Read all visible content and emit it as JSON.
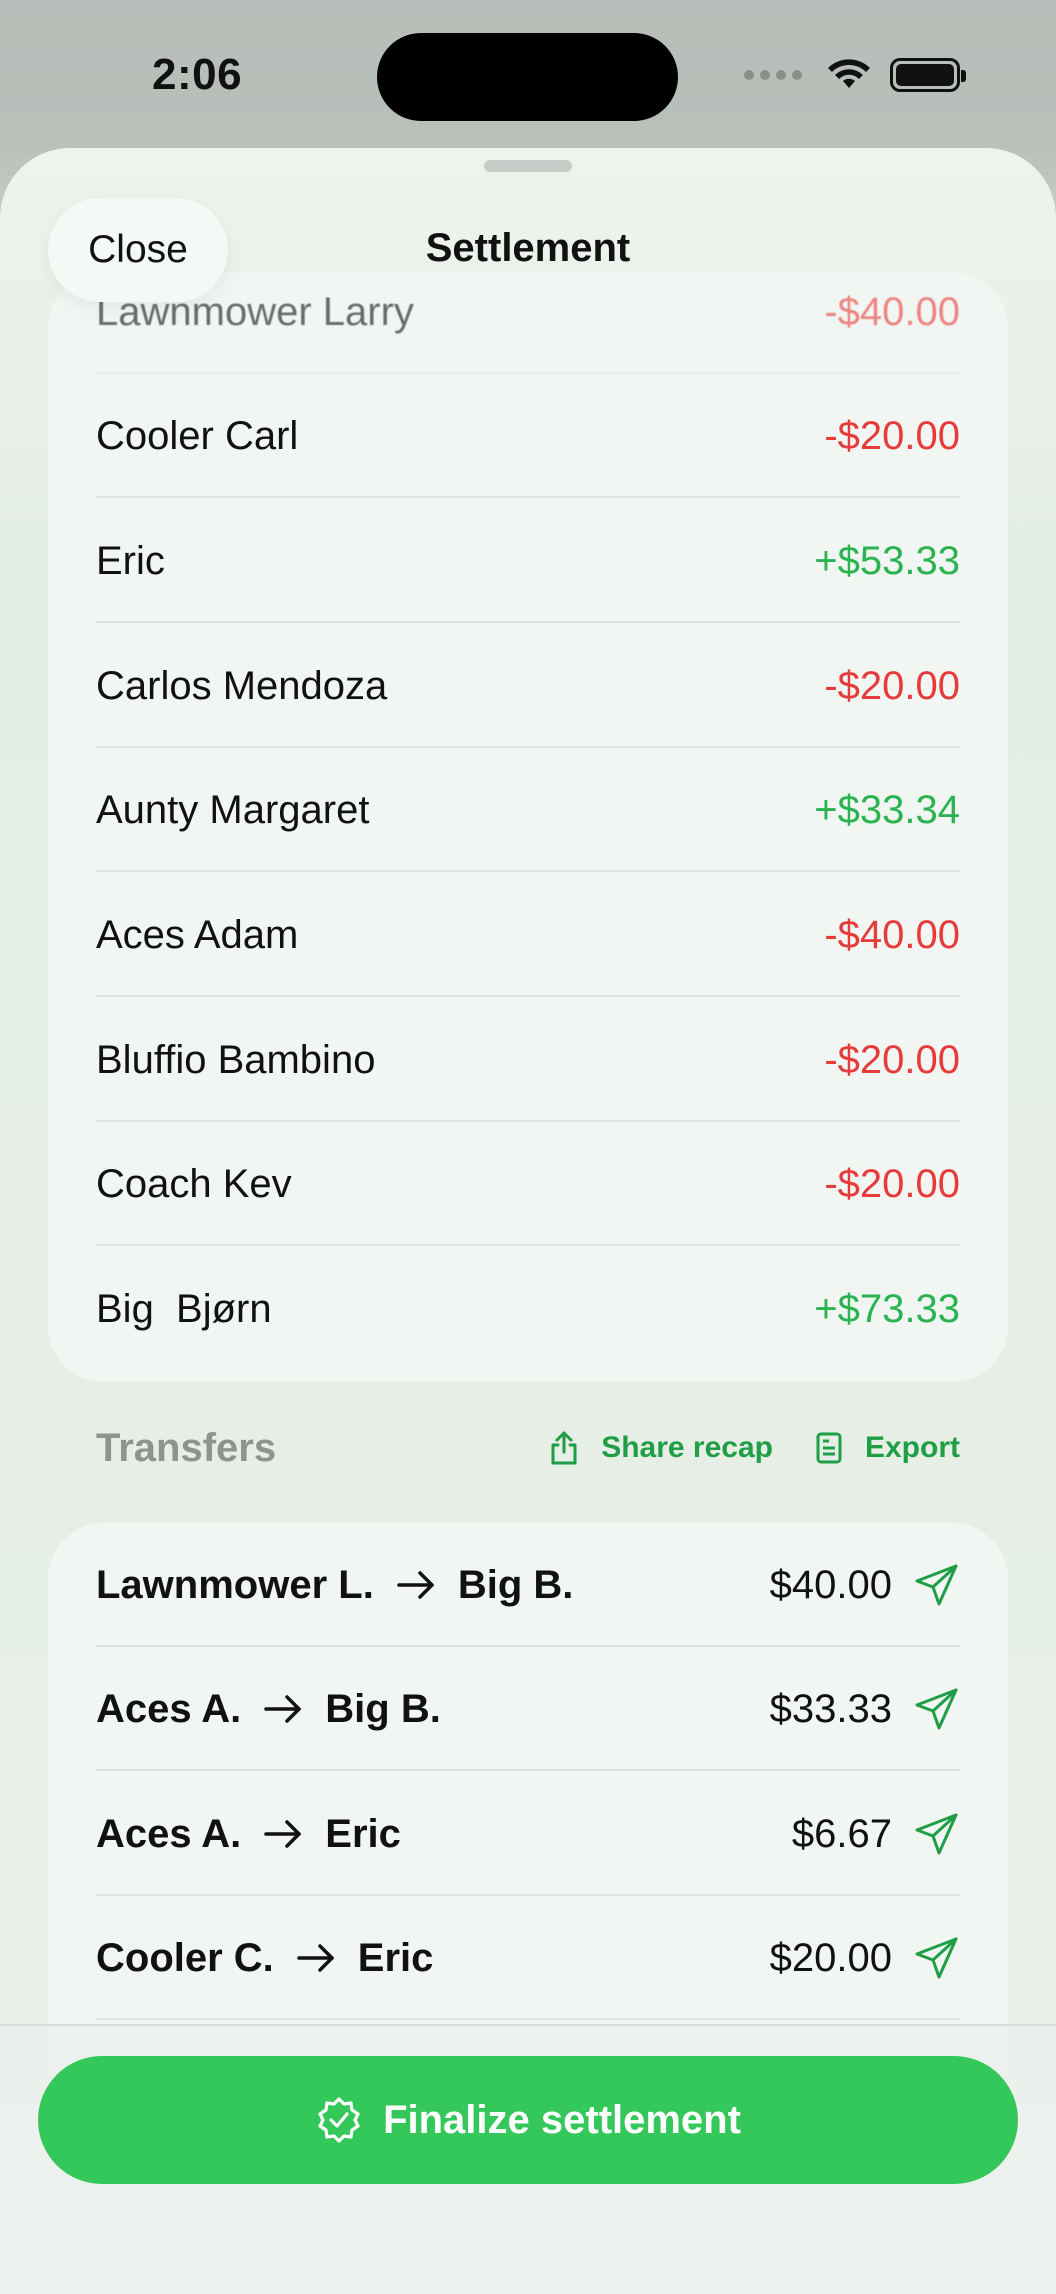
{
  "status": {
    "time": "2:06"
  },
  "sheet": {
    "close_label": "Close",
    "title": "Settlement"
  },
  "balances": [
    {
      "name": "Lawnmower Larry",
      "amount": "-$40.00",
      "sign": "neg"
    },
    {
      "name": "Cooler Carl",
      "amount": "-$20.00",
      "sign": "neg"
    },
    {
      "name": "Eric",
      "amount": "+$53.33",
      "sign": "pos"
    },
    {
      "name": "Carlos Mendoza",
      "amount": "-$20.00",
      "sign": "neg"
    },
    {
      "name": "Aunty Margaret",
      "amount": "+$33.34",
      "sign": "pos"
    },
    {
      "name": "Aces Adam",
      "amount": "-$40.00",
      "sign": "neg"
    },
    {
      "name": "Bluffio Bambino",
      "amount": "-$20.00",
      "sign": "neg"
    },
    {
      "name": "Coach Kev",
      "amount": "-$20.00",
      "sign": "neg"
    },
    {
      "name": "Big  Bjørn",
      "amount": "+$73.33",
      "sign": "pos"
    }
  ],
  "transfers": {
    "title": "Transfers",
    "share_label": "Share recap",
    "export_label": "Export",
    "rows": [
      {
        "from": "Lawnmower L.",
        "to": "Big B.",
        "amount": "$40.00"
      },
      {
        "from": "Aces A.",
        "to": "Big B.",
        "amount": "$33.33"
      },
      {
        "from": "Aces A.",
        "to": "Eric",
        "amount": "$6.67"
      },
      {
        "from": "Cooler C.",
        "to": "Eric",
        "amount": "$20.00"
      }
    ]
  },
  "footer": {
    "finalize_label": "Finalize settlement"
  },
  "colors": {
    "accent": "#34c759",
    "accent_text": "#1f9e45",
    "negative": "#e63b3b",
    "positive": "#2bb352"
  }
}
